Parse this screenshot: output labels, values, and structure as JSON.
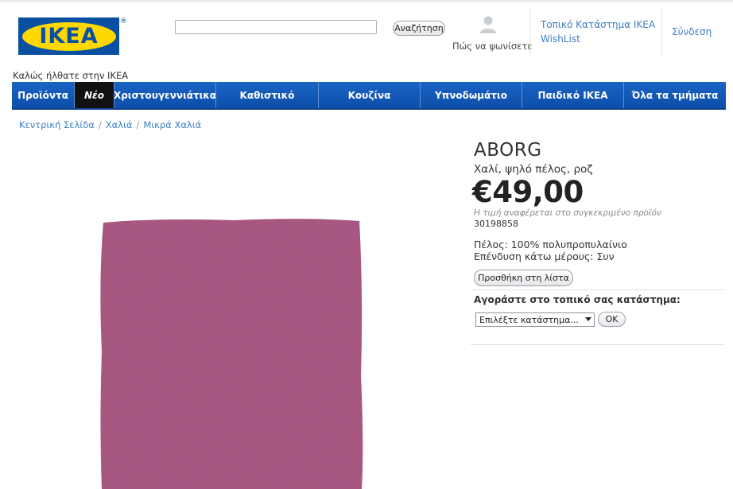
{
  "header": {
    "logo_text": "IKEA",
    "registered_mark": "®",
    "search": {
      "value": "",
      "placeholder": ""
    },
    "search_button": "Αναζήτηση",
    "shop_label": "Πώς να ψωνίσετε",
    "store_link": "Τοπικό Κατάστημα IKEA",
    "wishlist_link": "WishList",
    "login_link": "Σύνδεση",
    "welcome": "Καλώς ήλθατε στην IKEA"
  },
  "nav": {
    "items": [
      {
        "label": "Προϊόντα"
      },
      {
        "label": "Νέο"
      },
      {
        "label": "Χριστουγεννιάτικα"
      },
      {
        "label": "Καθιστικό"
      },
      {
        "label": "Κουζίνα"
      },
      {
        "label": "Υπνοδωμάτιο"
      },
      {
        "label": "Παιδικό IKEA"
      },
      {
        "label": "Όλα τα τμήματα"
      }
    ]
  },
  "breadcrumb": {
    "items": [
      "Κεντρική Σελίδα",
      "Χαλιά",
      "Μικρά Χαλιά"
    ],
    "separator": "/"
  },
  "product": {
    "name": "ABORG",
    "description": "Χαλί, ψηλό πέλος, ροζ",
    "price": "€49,00",
    "price_note": "Η τιμή αναφέρεται στο συγκεκριμένο προϊόν",
    "article_number": "30198858",
    "spec_pile": "Πέλος: 100% πολυπροπυλαίνιο",
    "spec_backing": "Επένδυση κάτω μέρους: Συν",
    "add_to_list": "Προσθήκη στη λίστα",
    "buy_local_label": "Αγοράστε στο τοπικό σας κατάστημα:",
    "store_select": "Επιλέξτε κατάστημα...",
    "ok_button": "OK",
    "rug_color": "#a8557f"
  },
  "colors": {
    "nav_blue": "#1359b8",
    "logo_blue": "#0a50a2",
    "logo_yellow": "#ffd800",
    "link_blue": "#3b7fc4"
  }
}
